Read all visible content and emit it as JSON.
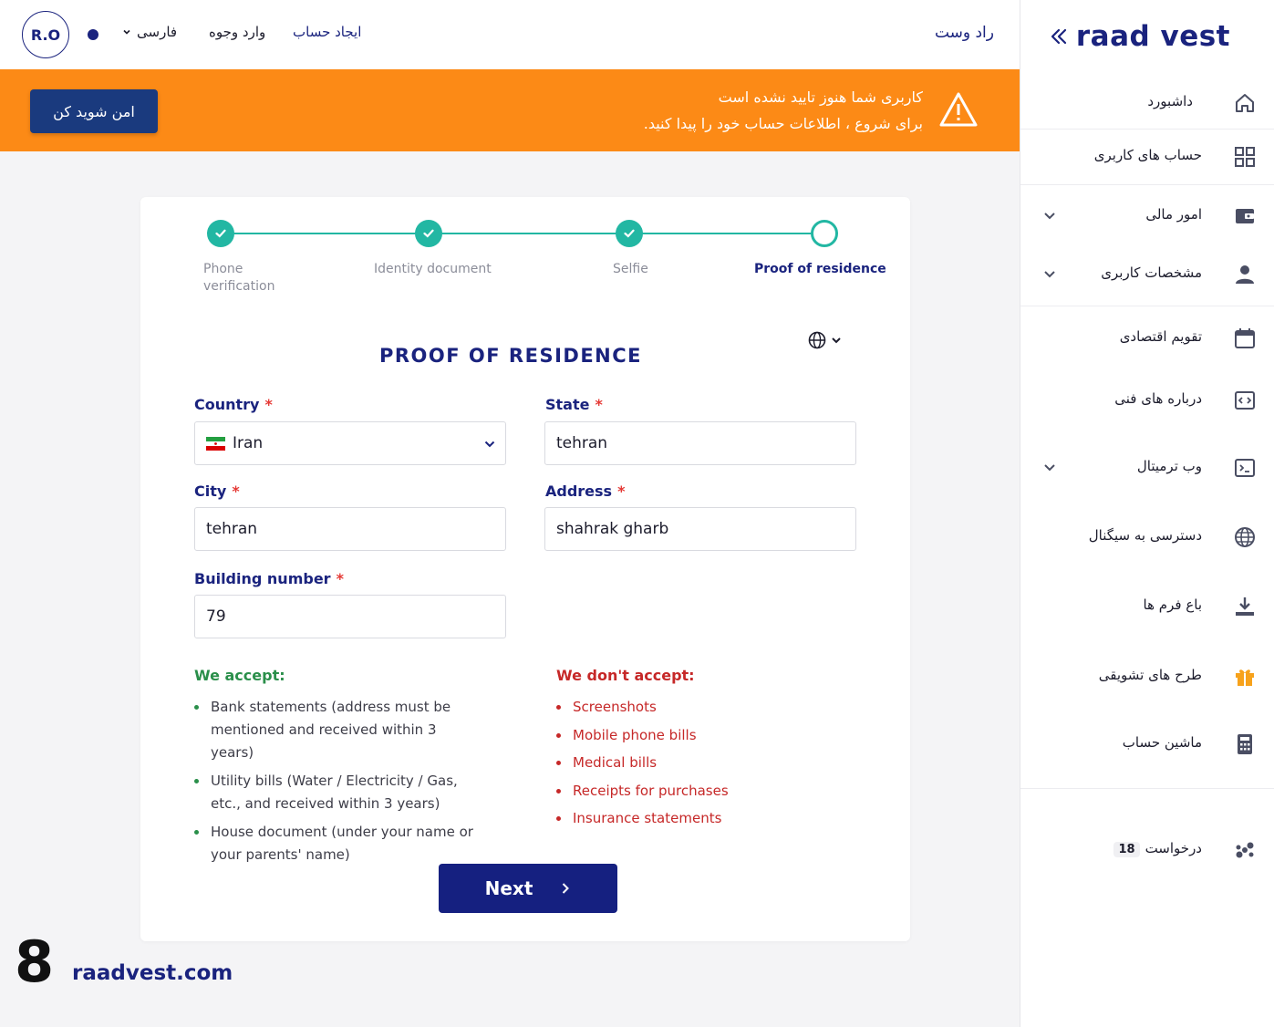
{
  "header": {
    "avatar_initials": "R.O",
    "language": "فارسی",
    "deposit": "وارد وجوه",
    "create_account": "ایجاد حساب",
    "brand": "راد وست"
  },
  "banner": {
    "line1": "کاربری شما هنوز تایید نشده است",
    "line2": "برای شروع ، اطلاعات حساب خود را پیدا کنید.",
    "button": "امن شوید کن"
  },
  "sidebar": {
    "logo": "raad vest",
    "items": [
      {
        "label": "داشبورد",
        "icon": "home-icon"
      },
      {
        "label": "حساب های کاربری",
        "icon": "grid-icon"
      },
      {
        "label": "امور مالی",
        "icon": "wallet-icon"
      },
      {
        "label": "مشخصات کاربری",
        "icon": "user-icon"
      },
      {
        "label": "تقویم اقتصادی",
        "icon": "calendar-icon"
      },
      {
        "label": "درباره های فنی",
        "icon": "code-icon"
      },
      {
        "label": "وب ترمیتال",
        "icon": "terminal-icon"
      },
      {
        "label": "دسترسی به سیگنال",
        "icon": "globe-icon"
      },
      {
        "label": "باع فرم ها",
        "icon": "download-icon"
      },
      {
        "label": "طرح های تشویقی",
        "icon": "gift-icon"
      },
      {
        "label": "ماشین حساب",
        "icon": "calculator-icon"
      },
      {
        "label": "درخواست",
        "icon": "requests-icon",
        "badge": "18"
      }
    ]
  },
  "stepper": {
    "steps": [
      {
        "label_line1": "Phone",
        "label_line2": "verification",
        "status": "done"
      },
      {
        "label_line1": "Identity document",
        "status": "done"
      },
      {
        "label_line1": "Selfie",
        "status": "done"
      },
      {
        "label_line1": "Proof of residence",
        "status": "current"
      }
    ]
  },
  "form": {
    "title": "PROOF OF RESIDENCE",
    "country_label": "Country",
    "country_value": "Iran",
    "state_label": "State",
    "state_value": "tehran",
    "city_label": "City",
    "city_value": "tehran",
    "address_label": "Address",
    "address_value": "shahrak gharb",
    "building_label": "Building number",
    "building_value": "79",
    "required_mark": "*"
  },
  "accept": {
    "title": "We accept:",
    "items": [
      "Bank statements (address must be mentioned and received within 3 years)",
      "Utility bills (Water / Electricity / Gas, etc., and received within 3 years)",
      "House document (under your name or your parents' name)"
    ]
  },
  "reject": {
    "title": "We don't accept:",
    "items": [
      "Screenshots",
      "Mobile phone bills",
      "Medical bills",
      "Receipts for purchases",
      "Insurance statements"
    ]
  },
  "next_button": "Next",
  "watermark": {
    "number": "8",
    "site": "raadvest.com"
  },
  "colors": {
    "accent": "#1a237e",
    "warning": "#fc8a16",
    "step": "#22b7a3",
    "error": "#c62828",
    "success": "#2a8f4a"
  }
}
